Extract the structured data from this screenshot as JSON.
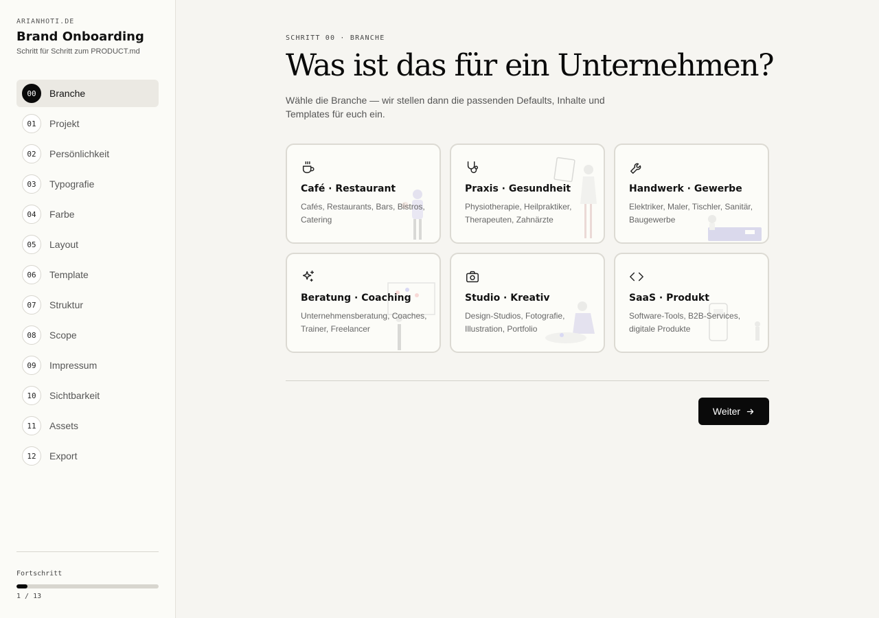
{
  "sidebar": {
    "domain": "ARIANHOTI.DE",
    "title": "Brand Onboarding",
    "subtitle": "Schritt für Schritt zum PRODUCT.md",
    "steps": [
      {
        "num": "00",
        "label": "Branche"
      },
      {
        "num": "01",
        "label": "Projekt"
      },
      {
        "num": "02",
        "label": "Persönlichkeit"
      },
      {
        "num": "03",
        "label": "Typografie"
      },
      {
        "num": "04",
        "label": "Farbe"
      },
      {
        "num": "05",
        "label": "Layout"
      },
      {
        "num": "06",
        "label": "Template"
      },
      {
        "num": "07",
        "label": "Struktur"
      },
      {
        "num": "08",
        "label": "Scope"
      },
      {
        "num": "09",
        "label": "Impressum"
      },
      {
        "num": "10",
        "label": "Sichtbarkeit"
      },
      {
        "num": "11",
        "label": "Assets"
      },
      {
        "num": "12",
        "label": "Export"
      }
    ],
    "active_step": "00",
    "progress": {
      "label": "Fortschritt",
      "count": "1 / 13",
      "fraction": 0.077
    }
  },
  "main": {
    "eyebrow": "SCHRITT 00 · BRANCHE",
    "headline": "Was ist das für ein Unternehmen?",
    "lead": "Wähle die Branche — wir stellen dann die passenden Defaults, Inhalte und Templates für euch ein.",
    "cards": [
      {
        "icon": "coffee-cup-icon",
        "title": "Café · Restaurant",
        "desc": "Cafés, Restaurants, Bars, Bistros, Catering"
      },
      {
        "icon": "stethoscope-icon",
        "title": "Praxis · Gesundheit",
        "desc": "Physiotherapie, Heilpraktiker, Therapeuten, Zahnärzte"
      },
      {
        "icon": "wrench-icon",
        "title": "Handwerk · Gewerbe",
        "desc": "Elektriker, Maler, Tischler, Sanitär, Baugewerbe"
      },
      {
        "icon": "sparkles-icon",
        "title": "Beratung · Coaching",
        "desc": "Unternehmensberatung, Coaches, Trainer, Freelancer"
      },
      {
        "icon": "camera-icon",
        "title": "Studio · Kreativ",
        "desc": "Design-Studios, Fotografie, Illustration, Portfolio"
      },
      {
        "icon": "code-icon",
        "title": "SaaS · Produkt",
        "desc": "Software-Tools, B2B-Services, digitale Produkte"
      }
    ],
    "next_label": "Weiter"
  },
  "colors": {
    "accent": "#0a0a0a",
    "background": "#f6f5f1",
    "sidebar_bg": "#fbfbf7",
    "card_border": "#dcdad3"
  }
}
